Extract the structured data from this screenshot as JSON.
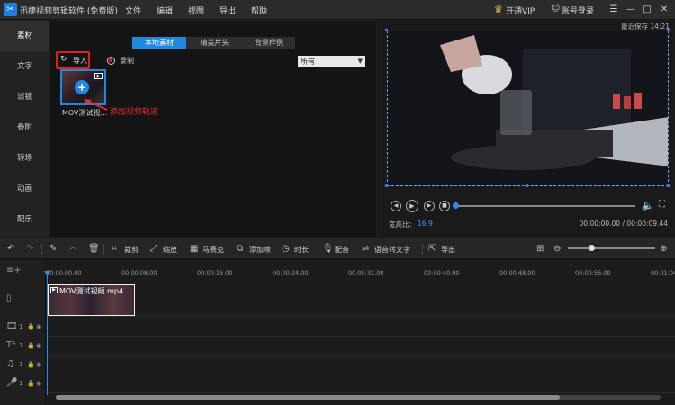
{
  "app": {
    "title": "迅捷视频剪辑软件 (免费版)",
    "menu": [
      "文件",
      "编辑",
      "视图",
      "导出",
      "帮助"
    ],
    "vip_label": "开通VIP",
    "login_label": "账号登录",
    "window_controls": [
      "feedback-icon",
      "minimize-icon",
      "maximize-icon",
      "close-icon"
    ]
  },
  "sidebar": {
    "items": [
      "素材",
      "文字",
      "滤镜",
      "叠附",
      "转场",
      "动画",
      "配乐"
    ],
    "active_index": 0
  },
  "media": {
    "tabs": [
      "本地素材",
      "精美片头",
      "背景样例"
    ],
    "active_tab": 0,
    "import_label": "导入",
    "record_label": "录制",
    "filter_value": "所有",
    "item_name": "MOV测试视...",
    "hint_text": "添加视频轨道"
  },
  "preview": {
    "autosave": "最近保存 14:21",
    "aspect_label": "宽高比：",
    "aspect_value": "16:9",
    "time": "00:00:00.00 / 00:00:09.44",
    "progress": 0.0
  },
  "toolbar": {
    "items": [
      {
        "icon": "crop-icon",
        "label": "裁剪"
      },
      {
        "icon": "zoom-icon",
        "label": "缩放"
      },
      {
        "icon": "mosaic-icon",
        "label": "马赛克"
      },
      {
        "icon": "add-frame-icon",
        "label": "添加帧"
      },
      {
        "icon": "duration-icon",
        "label": "时长"
      },
      {
        "icon": "dub-icon",
        "label": "配音"
      },
      {
        "icon": "speech-to-text-icon",
        "label": "语音转文字"
      },
      {
        "icon": "export-icon",
        "label": "导出"
      }
    ],
    "zoom_level": 0.27
  },
  "timeline": {
    "ticks": [
      "00:00:00.00",
      "00:00:08.00",
      "00:00:16.00",
      "00:00:24.00",
      "00:00:32.00",
      "00:00:40.00",
      "00:00:48.00",
      "00:00:56.00",
      "00:01:04"
    ],
    "track_numbers": [
      "1",
      "1",
      "1",
      "1"
    ],
    "clip_name": "MOV测试视频.mp4"
  },
  "colors": {
    "accent": "#1e88e5",
    "highlight_red": "#e0201e",
    "vip_gold": "#e6b84a"
  }
}
